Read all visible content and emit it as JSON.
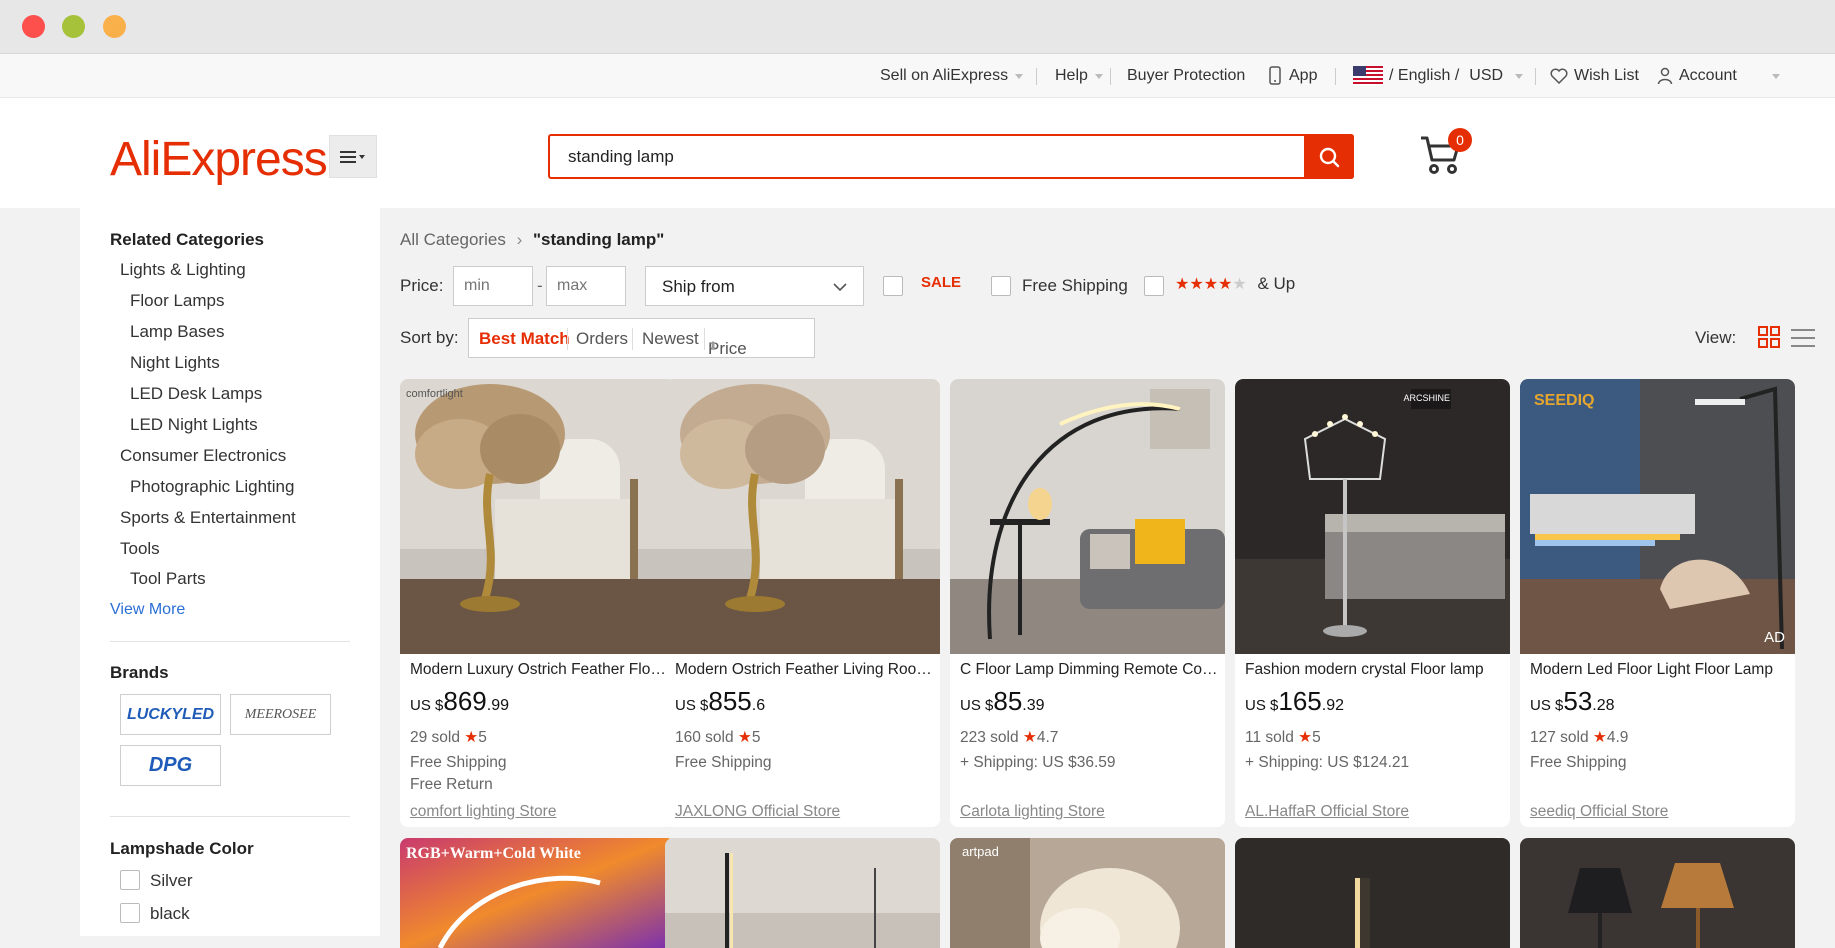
{
  "topnav": {
    "sell": "Sell on AliExpress",
    "help": "Help",
    "buyer_protection": "Buyer Protection",
    "app": "App",
    "language": "/ English /",
    "currency": "USD",
    "wishlist": "Wish List",
    "account": "Account"
  },
  "header": {
    "logo": "AliExpress",
    "search_value": "standing lamp",
    "cart_count": "0"
  },
  "sidebar": {
    "related_title": "Related Categories",
    "categories": [
      {
        "label": "Lights & Lighting",
        "level": 0
      },
      {
        "label": "Floor Lamps",
        "level": 1
      },
      {
        "label": "Lamp Bases",
        "level": 1
      },
      {
        "label": "Night Lights",
        "level": 1
      },
      {
        "label": "LED Desk Lamps",
        "level": 1
      },
      {
        "label": "LED Night Lights",
        "level": 1
      },
      {
        "label": "Consumer Electronics",
        "level": 0
      },
      {
        "label": "Photographic Lighting",
        "level": 1
      },
      {
        "label": "Sports & Entertainment",
        "level": 0
      },
      {
        "label": "Tools",
        "level": 0
      },
      {
        "label": "Tool Parts",
        "level": 1
      }
    ],
    "view_more": "View More",
    "brands_title": "Brands",
    "brands": [
      "LUCKYLED",
      "MEEROSEE",
      "DPG"
    ],
    "lampshade_title": "Lampshade Color",
    "colors": [
      "Silver",
      "black"
    ]
  },
  "main": {
    "crumb_root": "All Categories",
    "crumb_query": "\"standing lamp\"",
    "price_label": "Price:",
    "min_placeholder": "min",
    "max_placeholder": "max",
    "ship_from": "Ship from",
    "sale": "SALE",
    "free_shipping": "Free Shipping",
    "rating_filter": "& Up",
    "sort_label": "Sort by:",
    "sort_options": [
      "Best Match",
      "Orders",
      "Newest",
      "Price"
    ],
    "view_label": "View:"
  },
  "products": [
    {
      "title": "Modern Luxury Ostrich Feather Floor Lamp",
      "cur": "US $",
      "int": "869",
      "dec": ".99",
      "sold": "29 sold",
      "rating": "5",
      "ship": "Free Shipping",
      "ret": "Free Return",
      "store": "comfort lighting Store",
      "watermark": "comfortlight"
    },
    {
      "title": "Modern Ostrich Feather Living Room Floor Lamp",
      "cur": "US $",
      "int": "855",
      "dec": ".6",
      "sold": "160 sold",
      "rating": "5",
      "ship": "Free Shipping",
      "ret": "",
      "store": "JAXLONG Official Store",
      "watermark": ""
    },
    {
      "title": "C Floor Lamp Dimming Remote Control",
      "cur": "US $",
      "int": "85",
      "dec": ".39",
      "sold": "223 sold",
      "rating": "4.7",
      "ship": "+ Shipping: US $36.59",
      "ret": "",
      "store": "Carlota lighting Store",
      "watermark": ""
    },
    {
      "title": "Fashion modern crystal Floor lamp",
      "cur": "US $",
      "int": "165",
      "dec": ".92",
      "sold": "11 sold",
      "rating": "5",
      "ship": "+ Shipping: US $124.21",
      "ret": "",
      "store": "AL.HaffaR Official Store",
      "watermark": "ARCSHINE"
    },
    {
      "title": "Modern Led Floor Light Floor Lamp",
      "cur": "US $",
      "int": "53",
      "dec": ".28",
      "sold": "127 sold",
      "rating": "4.9",
      "ship": "Free Shipping",
      "ret": "",
      "store": "seediq Official Store",
      "watermark": "SEEDIQ",
      "ad": "AD"
    }
  ],
  "second_row": {
    "first_banner": "RGB+Warm+Cold White",
    "third_brand": "artpad"
  }
}
